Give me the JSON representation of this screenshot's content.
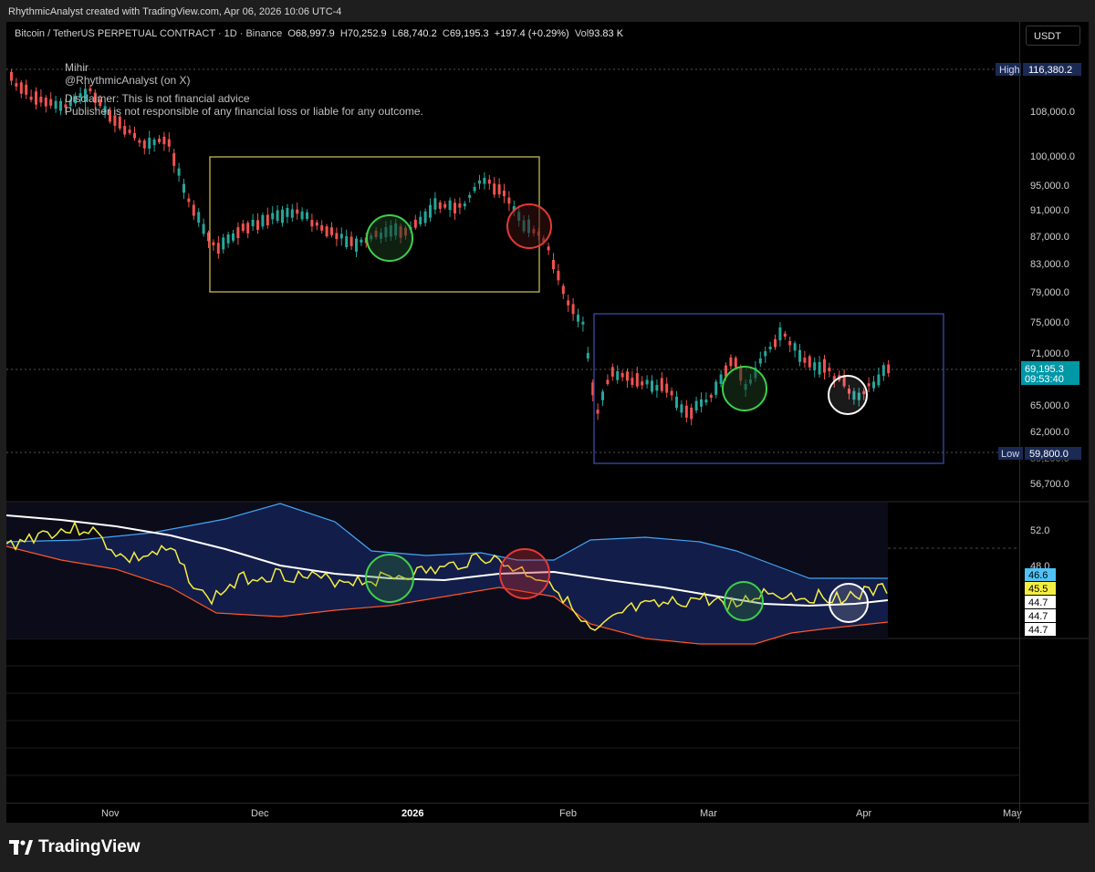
{
  "header": {
    "created_by": "RhythmicAnalyst created with TradingView.com, Apr 06, 2026 10:06 UTC-4"
  },
  "legend": {
    "symbol": "Bitcoin / TetherUS PERPETUAL CONTRACT · 1D · Binance",
    "open_label": "O",
    "open": "68,997.9",
    "high_label": "H",
    "high": "70,252.9",
    "low_label": "L",
    "low": "68,740.2",
    "close_label": "C",
    "close": "69,195.3",
    "change": "+197.4 (+0.29%)",
    "vol_label": "Vol",
    "vol": "93.83 K"
  },
  "currency_button": "USDT",
  "author": {
    "name": "Mihir",
    "handle": "@RhythmicAnalyst (on X)",
    "disclaimer_1": "Disclaimer: This is not financial advice",
    "disclaimer_2": "Publisher is not responsible of any financial loss or liable for any outcome."
  },
  "price_axis_ticks": [
    "108,000.0",
    "100,000.0",
    "95,000.0",
    "91,000.0",
    "87,000.0",
    "83,000.0",
    "79,000.0",
    "75,000.0",
    "71,000.0",
    "65,000.0",
    "62,000.0",
    "56,700.0"
  ],
  "tags": {
    "high_label": "High",
    "high_value": "116,380.2",
    "low_label": "Low",
    "low_value": "59,800.0",
    "last_price": "69,195.3",
    "countdown": "09:53:40",
    "low_axis_partial": "59,200.0"
  },
  "indicator": {
    "tick_52": "52.0",
    "tick_48": "48.0",
    "upper_value": "46.6",
    "rsi_value": "45.5",
    "basis_value": "44.7",
    "mid_value": "44.7",
    "lower_value": "44.7"
  },
  "time_axis": [
    "Nov",
    "Dec",
    "2026",
    "Feb",
    "Mar",
    "Apr",
    "May"
  ],
  "footer": {
    "logo_text": "TradingView"
  },
  "colors": {
    "up": "#26a69a",
    "down": "#ef5350",
    "yellow_box": "#d4c45a",
    "blue_box": "#3f51b5",
    "green_circle": "#3fcf4a",
    "red_circle": "#e53935",
    "white_circle": "#ffffff",
    "rsi": "#f4ee42",
    "basis": "#ffffff",
    "upper_band": "#42a5f5",
    "lower_band": "#ff5722",
    "band_fill": "#152152"
  }
}
